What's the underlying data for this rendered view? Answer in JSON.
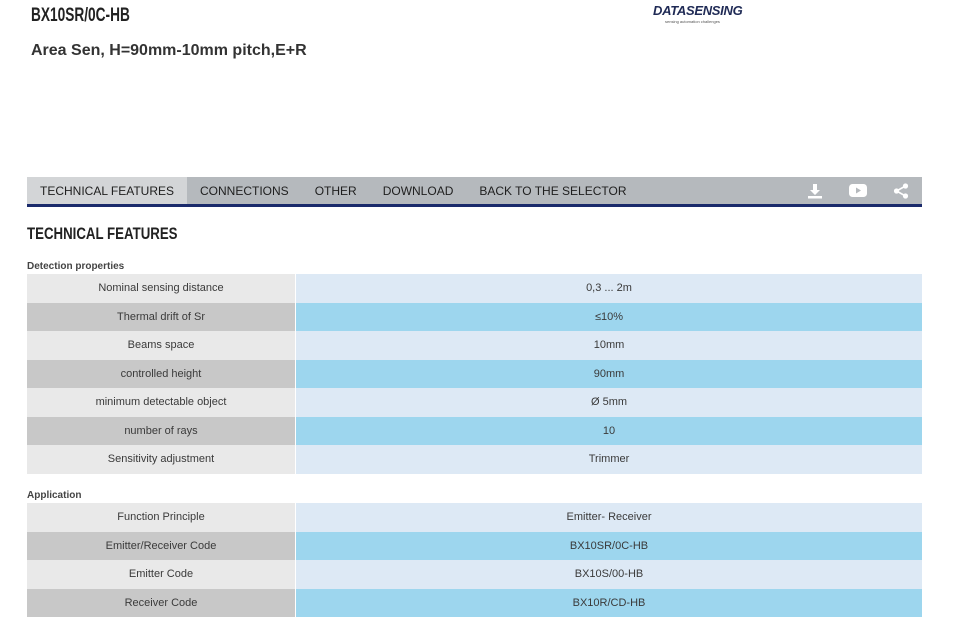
{
  "header": {
    "product_code": "BX10SR/0C-HB",
    "product_description": "Area Sen, H=90mm-10mm pitch,E+R",
    "logo_text": "DATASENSING",
    "logo_tagline": "sensing automation challenges"
  },
  "tabs": [
    {
      "label": "TECHNICAL FEATURES",
      "active": true
    },
    {
      "label": "CONNECTIONS",
      "active": false
    },
    {
      "label": "OTHER",
      "active": false
    },
    {
      "label": "DOWNLOAD",
      "active": false
    },
    {
      "label": "BACK TO THE SELECTOR",
      "active": false
    }
  ],
  "tab_icons": [
    "download-icon",
    "youtube-icon",
    "share-icon"
  ],
  "section_title": "TECHNICAL FEATURES",
  "groups": [
    {
      "label": "Detection properties",
      "rows": [
        {
          "key": "Nominal sensing distance",
          "value": "0,3 ... 2m"
        },
        {
          "key": "Thermal drift of Sr",
          "value": "≤10%"
        },
        {
          "key": "Beams space",
          "value": "10mm"
        },
        {
          "key": "controlled height",
          "value": "90mm"
        },
        {
          "key": "minimum detectable object",
          "value": "Ø 5mm"
        },
        {
          "key": "number of rays",
          "value": "10"
        },
        {
          "key": "Sensitivity adjustment",
          "value": "Trimmer"
        }
      ]
    },
    {
      "label": "Application",
      "rows": [
        {
          "key": "Function Principle",
          "value": "Emitter- Receiver"
        },
        {
          "key": "Emitter/Receiver Code",
          "value": "BX10SR/0C-HB"
        },
        {
          "key": "Emitter Code",
          "value": "BX10S/00-HB"
        },
        {
          "key": "Receiver Code",
          "value": "BX10R/CD-HB"
        }
      ]
    }
  ],
  "colors": {
    "tab_bar": "#b5b9bd",
    "tab_active": "#d3d5d7",
    "tab_underline": "#1a2a6b",
    "row_value_light": "#dde9f5",
    "row_value_dark": "#9dd6ee"
  }
}
